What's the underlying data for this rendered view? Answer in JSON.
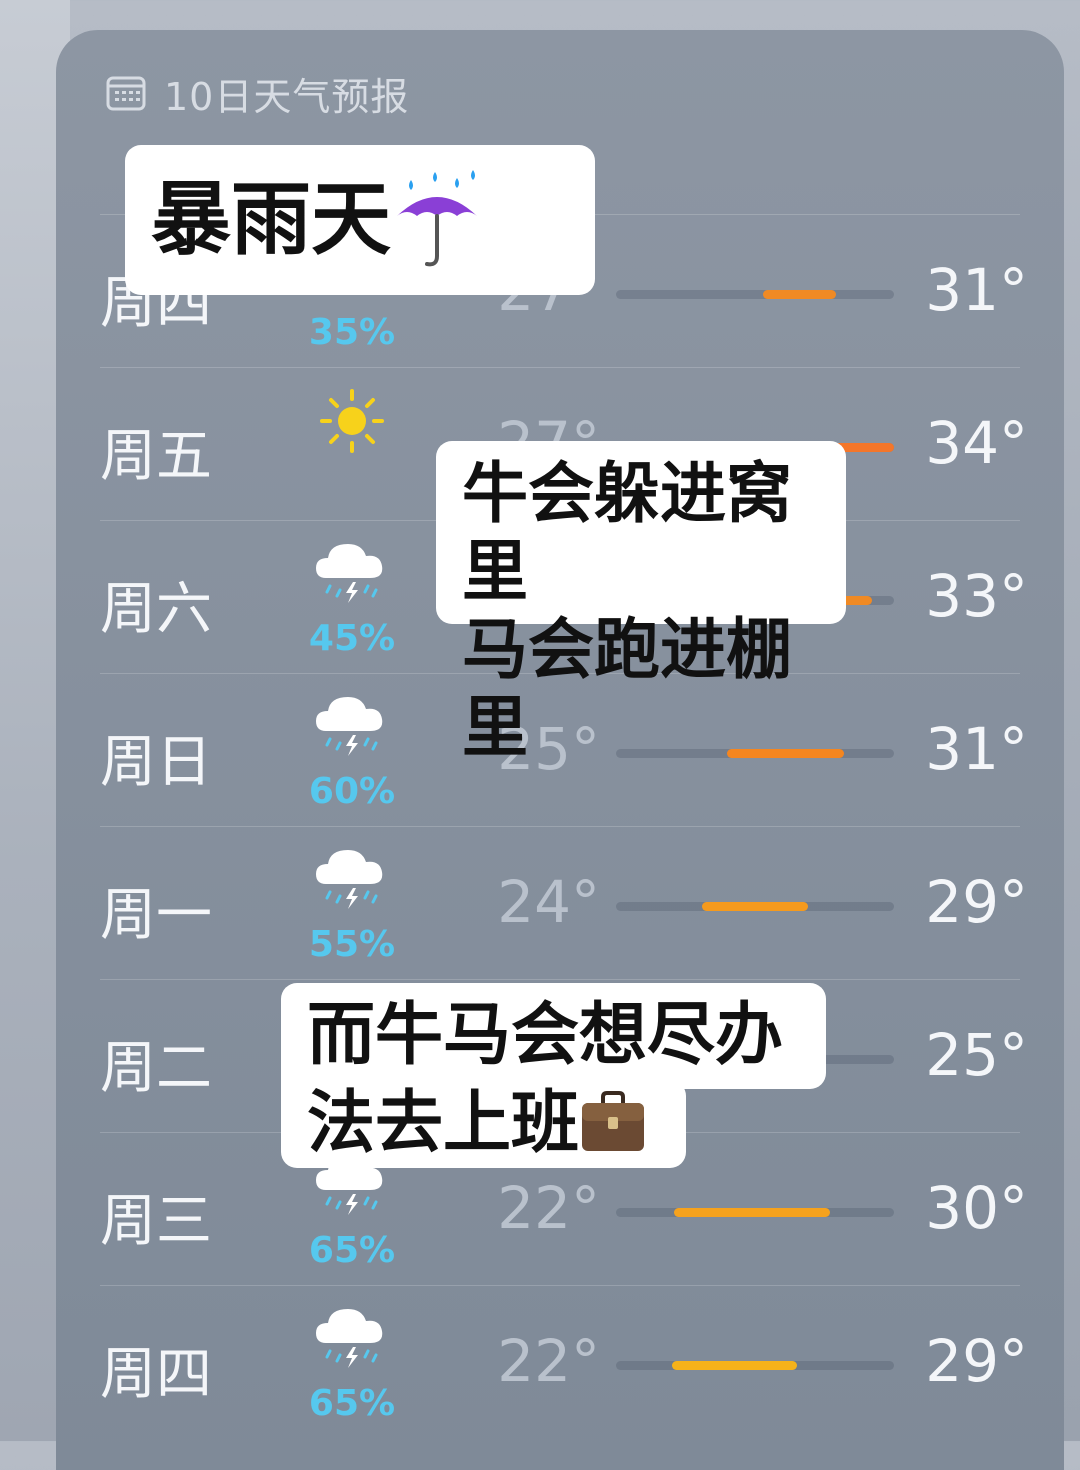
{
  "header": {
    "title": "10日天气预报",
    "icon": "calendar-icon"
  },
  "colors": {
    "precip": "#56c8ee",
    "range_warm": "#f08a24",
    "range_mild": "#f6a21d",
    "card_bg": "#8b95a2"
  },
  "rows": [
    {
      "day": "周四",
      "icon": "rain-icon",
      "precip": "35%",
      "low": "27°",
      "high": "31°",
      "range": [
        0.53,
        0.79
      ],
      "color": "#f08a24"
    },
    {
      "day": "周五",
      "icon": "sun-icon",
      "precip": "",
      "low": "27°",
      "high": "34°",
      "range": [
        0.53,
        1.0
      ],
      "color": "#f4762a"
    },
    {
      "day": "周六",
      "icon": "thunderstorm-icon",
      "precip": "45%",
      "low": "",
      "high": "33°",
      "range": [
        0.6,
        0.92
      ],
      "color": "#f08a24"
    },
    {
      "day": "周日",
      "icon": "thunderstorm-icon",
      "precip": "60%",
      "low": "25°",
      "high": "31°",
      "range": [
        0.4,
        0.82
      ],
      "color": "#f5861f"
    },
    {
      "day": "周一",
      "icon": "thunderstorm-icon",
      "precip": "55%",
      "low": "24°",
      "high": "29°",
      "range": [
        0.31,
        0.69
      ],
      "color": "#f59a1d"
    },
    {
      "day": "周二",
      "icon": "thunderstorm-icon",
      "precip": "",
      "low": "",
      "high": "25°",
      "range": [
        0.0,
        0.0
      ],
      "color": "#f6a21d"
    },
    {
      "day": "周三",
      "icon": "thunderstorm-icon",
      "precip": "65%",
      "low": "22°",
      "high": "30°",
      "range": [
        0.21,
        0.77
      ],
      "color": "#f6a21d"
    },
    {
      "day": "周四",
      "icon": "thunderstorm-icon",
      "precip": "65%",
      "low": "22°",
      "high": "29°",
      "range": [
        0.2,
        0.65
      ],
      "color": "#f6b21a"
    }
  ],
  "overlays": {
    "title_text": "暴雨天",
    "title_emoji": "umbrella-rain-icon",
    "caption1_line1": "牛会躲进窝里",
    "caption1_line2": "马会跑进棚里",
    "caption2_line1": "而牛马会想尽办",
    "caption2_line2": "法去上班",
    "caption2_emoji": "briefcase-icon"
  }
}
